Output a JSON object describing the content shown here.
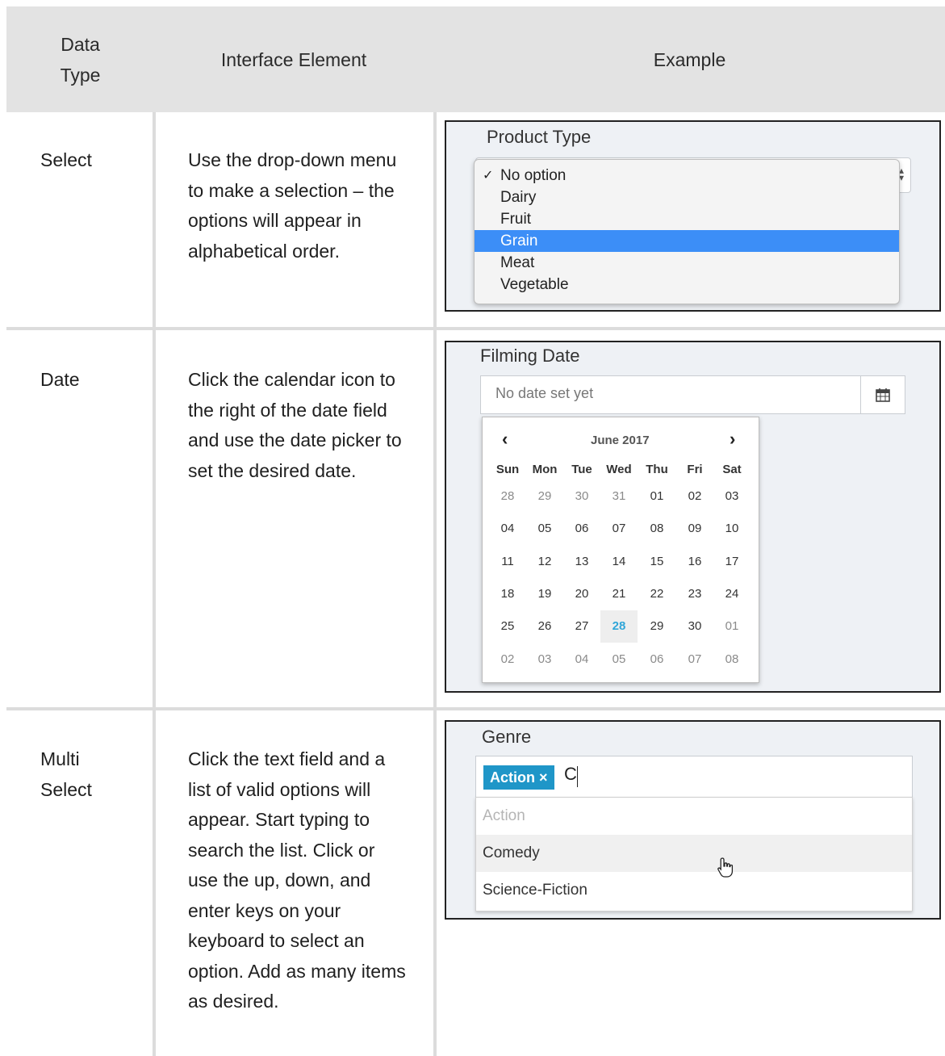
{
  "header": {
    "col1": "Data\nType",
    "col2": "Interface Element",
    "col3": "Example"
  },
  "rows": [
    {
      "type": "Select",
      "description": "Use the drop-down menu to make a selection – the options will appear in alphabetical order.",
      "example": {
        "label": "Product Type",
        "options": [
          "No option",
          "Dairy",
          "Fruit",
          "Grain",
          "Meat",
          "Vegetable"
        ],
        "checked_option": "No option",
        "highlighted_option": "Grain"
      }
    },
    {
      "type": "Date",
      "description": "Click the calendar icon to the right of the date field and use the date picker to set the desired date.",
      "example": {
        "label": "Filming Date",
        "placeholder": "No date set yet",
        "calendar": {
          "prev": "‹",
          "next": "›",
          "month_title": "June 2017",
          "weekdays": [
            "Sun",
            "Mon",
            "Tue",
            "Wed",
            "Thu",
            "Fri",
            "Sat"
          ],
          "weeks": [
            [
              "28",
              "29",
              "30",
              "31",
              "01",
              "02",
              "03"
            ],
            [
              "04",
              "05",
              "06",
              "07",
              "08",
              "09",
              "10"
            ],
            [
              "11",
              "12",
              "13",
              "14",
              "15",
              "16",
              "17"
            ],
            [
              "18",
              "19",
              "20",
              "21",
              "22",
              "23",
              "24"
            ],
            [
              "25",
              "26",
              "27",
              "28",
              "29",
              "30",
              "01"
            ],
            [
              "02",
              "03",
              "04",
              "05",
              "06",
              "07",
              "08"
            ]
          ],
          "today": "28"
        }
      }
    },
    {
      "type": "Multi\nSelect",
      "description": "Click the text field and a list of valid options will appear. Start typing to search the list. Click or use the up, down, and enter keys on your keyboard to select an option. Add as many items as desired.",
      "example": {
        "label": "Genre",
        "tag": "Action ×",
        "typed_text": "C",
        "options": [
          "Action",
          "Comedy",
          "Science-Fiction"
        ],
        "disabled_option": "Action",
        "hovered_option": "Comedy"
      }
    }
  ],
  "colors": {
    "header_bg": "#e3e3e3",
    "grid": "#dcdcdc",
    "select_highlight": "#3c8ef7",
    "tag_bg": "#1f96c8",
    "today": "#31a6d8"
  }
}
